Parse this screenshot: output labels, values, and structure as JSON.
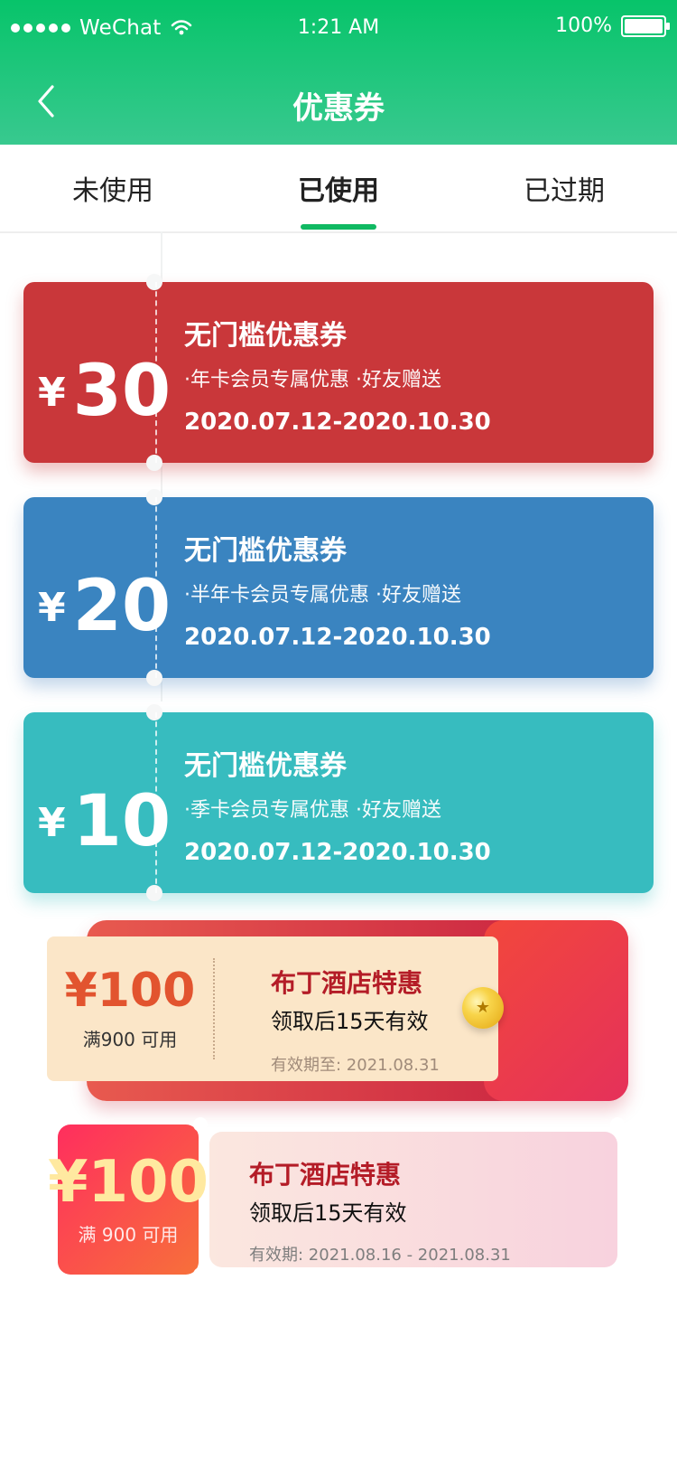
{
  "status_bar": {
    "carrier": "WeChat",
    "time": "1:21 AM",
    "battery": "100%"
  },
  "nav": {
    "title": "优惠券"
  },
  "tabs": [
    {
      "label": "未使用",
      "active": false
    },
    {
      "label": "已使用",
      "active": true
    },
    {
      "label": "已过期",
      "active": false
    }
  ],
  "coupons": [
    {
      "yen": "¥",
      "amount": "30",
      "title": "无门槛优惠券",
      "desc": "·年卡会员专属优惠 ·好友赠送",
      "date": "2020.07.12-2020.10.30",
      "color": "#c9373a"
    },
    {
      "yen": "¥",
      "amount": "20",
      "title": "无门槛优惠券",
      "desc": "·半年卡会员专属优惠 ·好友赠送",
      "date": "2020.07.12-2020.10.30",
      "color": "#3a84c0"
    },
    {
      "yen": "¥",
      "amount": "10",
      "title": "无门槛优惠券",
      "desc": "·季卡会员专属优惠 ·好友赠送",
      "date": "2020.07.12-2020.10.30",
      "color": "#37bcbf"
    }
  ],
  "hotel_coupon_1": {
    "amount": "¥100",
    "condition": "满900 可用",
    "title": "布丁酒店特惠",
    "sub": "领取后15天有效",
    "expiry": "有效期至: 2021.08.31"
  },
  "hotel_coupon_2": {
    "amount": "¥100",
    "condition": "满 900 可用",
    "title": "布丁酒店特惠",
    "sub": "领取后15天有效",
    "validity": "有效期: 2021.08.16 - 2021.08.31"
  }
}
